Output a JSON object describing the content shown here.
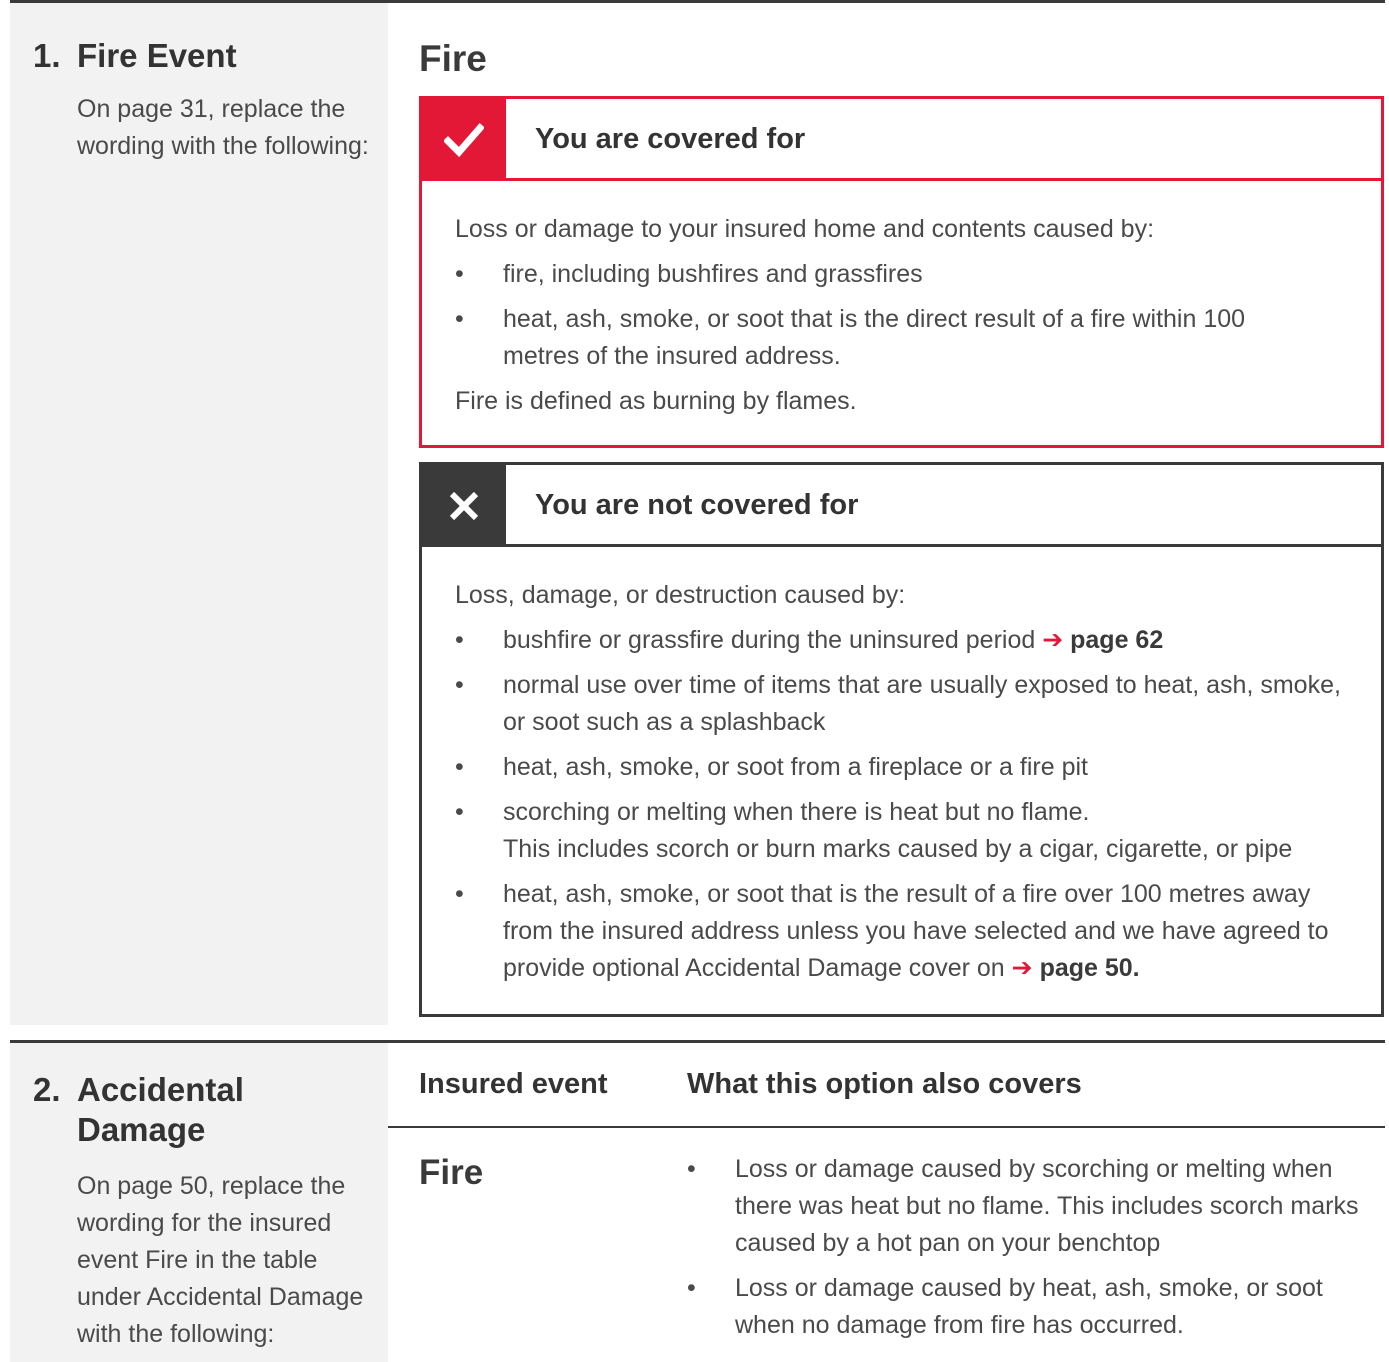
{
  "section1": {
    "number": "1.",
    "heading": "Fire Event",
    "instruction": "On page 31, replace the wording with the following:",
    "title": "Fire",
    "covered": {
      "heading": "You are covered for",
      "intro": "Loss or damage to your insured home and contents caused by:",
      "items": [
        "fire, including bushfires and grassfires",
        "heat, ash, smoke, or soot that is the direct result of a fire within 100 metres of the insured address."
      ],
      "outro": "Fire is defined as burning by flames."
    },
    "not_covered": {
      "heading": "You are not covered for",
      "intro": "Loss, damage, or destruction caused by:",
      "item1_text": "bushfire or grassfire during the uninsured period",
      "item1_ref": "page 62",
      "item2": "normal use over time of items that are usually exposed to heat, ash, smoke, or soot such as a splashback",
      "item3": "heat, ash, smoke, or soot from a fireplace or a fire pit",
      "item4_line1": "scorching or melting when there is heat but no flame.",
      "item4_line2": "This includes scorch or burn marks caused by a cigar, cigarette, or pipe",
      "item5_text": "heat, ash, smoke, or soot that is the result of a fire over 100 metres away from the insured address unless you have selected and we have agreed to provide optional Accidental Damage cover on",
      "item5_ref": "page 50."
    }
  },
  "section2": {
    "number": "2.",
    "heading_line1": "Accidental",
    "heading_line2": "Damage",
    "instruction": "On page 50, replace the wording for the insured event Fire in the table under Accidental Damage with the following:",
    "col1_header": "Insured event",
    "col2_header": "What this option also covers",
    "event": "Fire",
    "items": [
      "Loss or damage caused by scorching or melting when there was heat but no flame. This includes scorch marks caused by a hot pan on your benchtop",
      "Loss or damage caused by heat, ash, smoke, or soot when no damage from fire has occurred."
    ]
  },
  "glyphs": {
    "bullet": "•",
    "arrow": "➔"
  },
  "colors": {
    "accent": "#e31837",
    "dark": "#3a3a3a",
    "panel": "#f2f2f2"
  }
}
